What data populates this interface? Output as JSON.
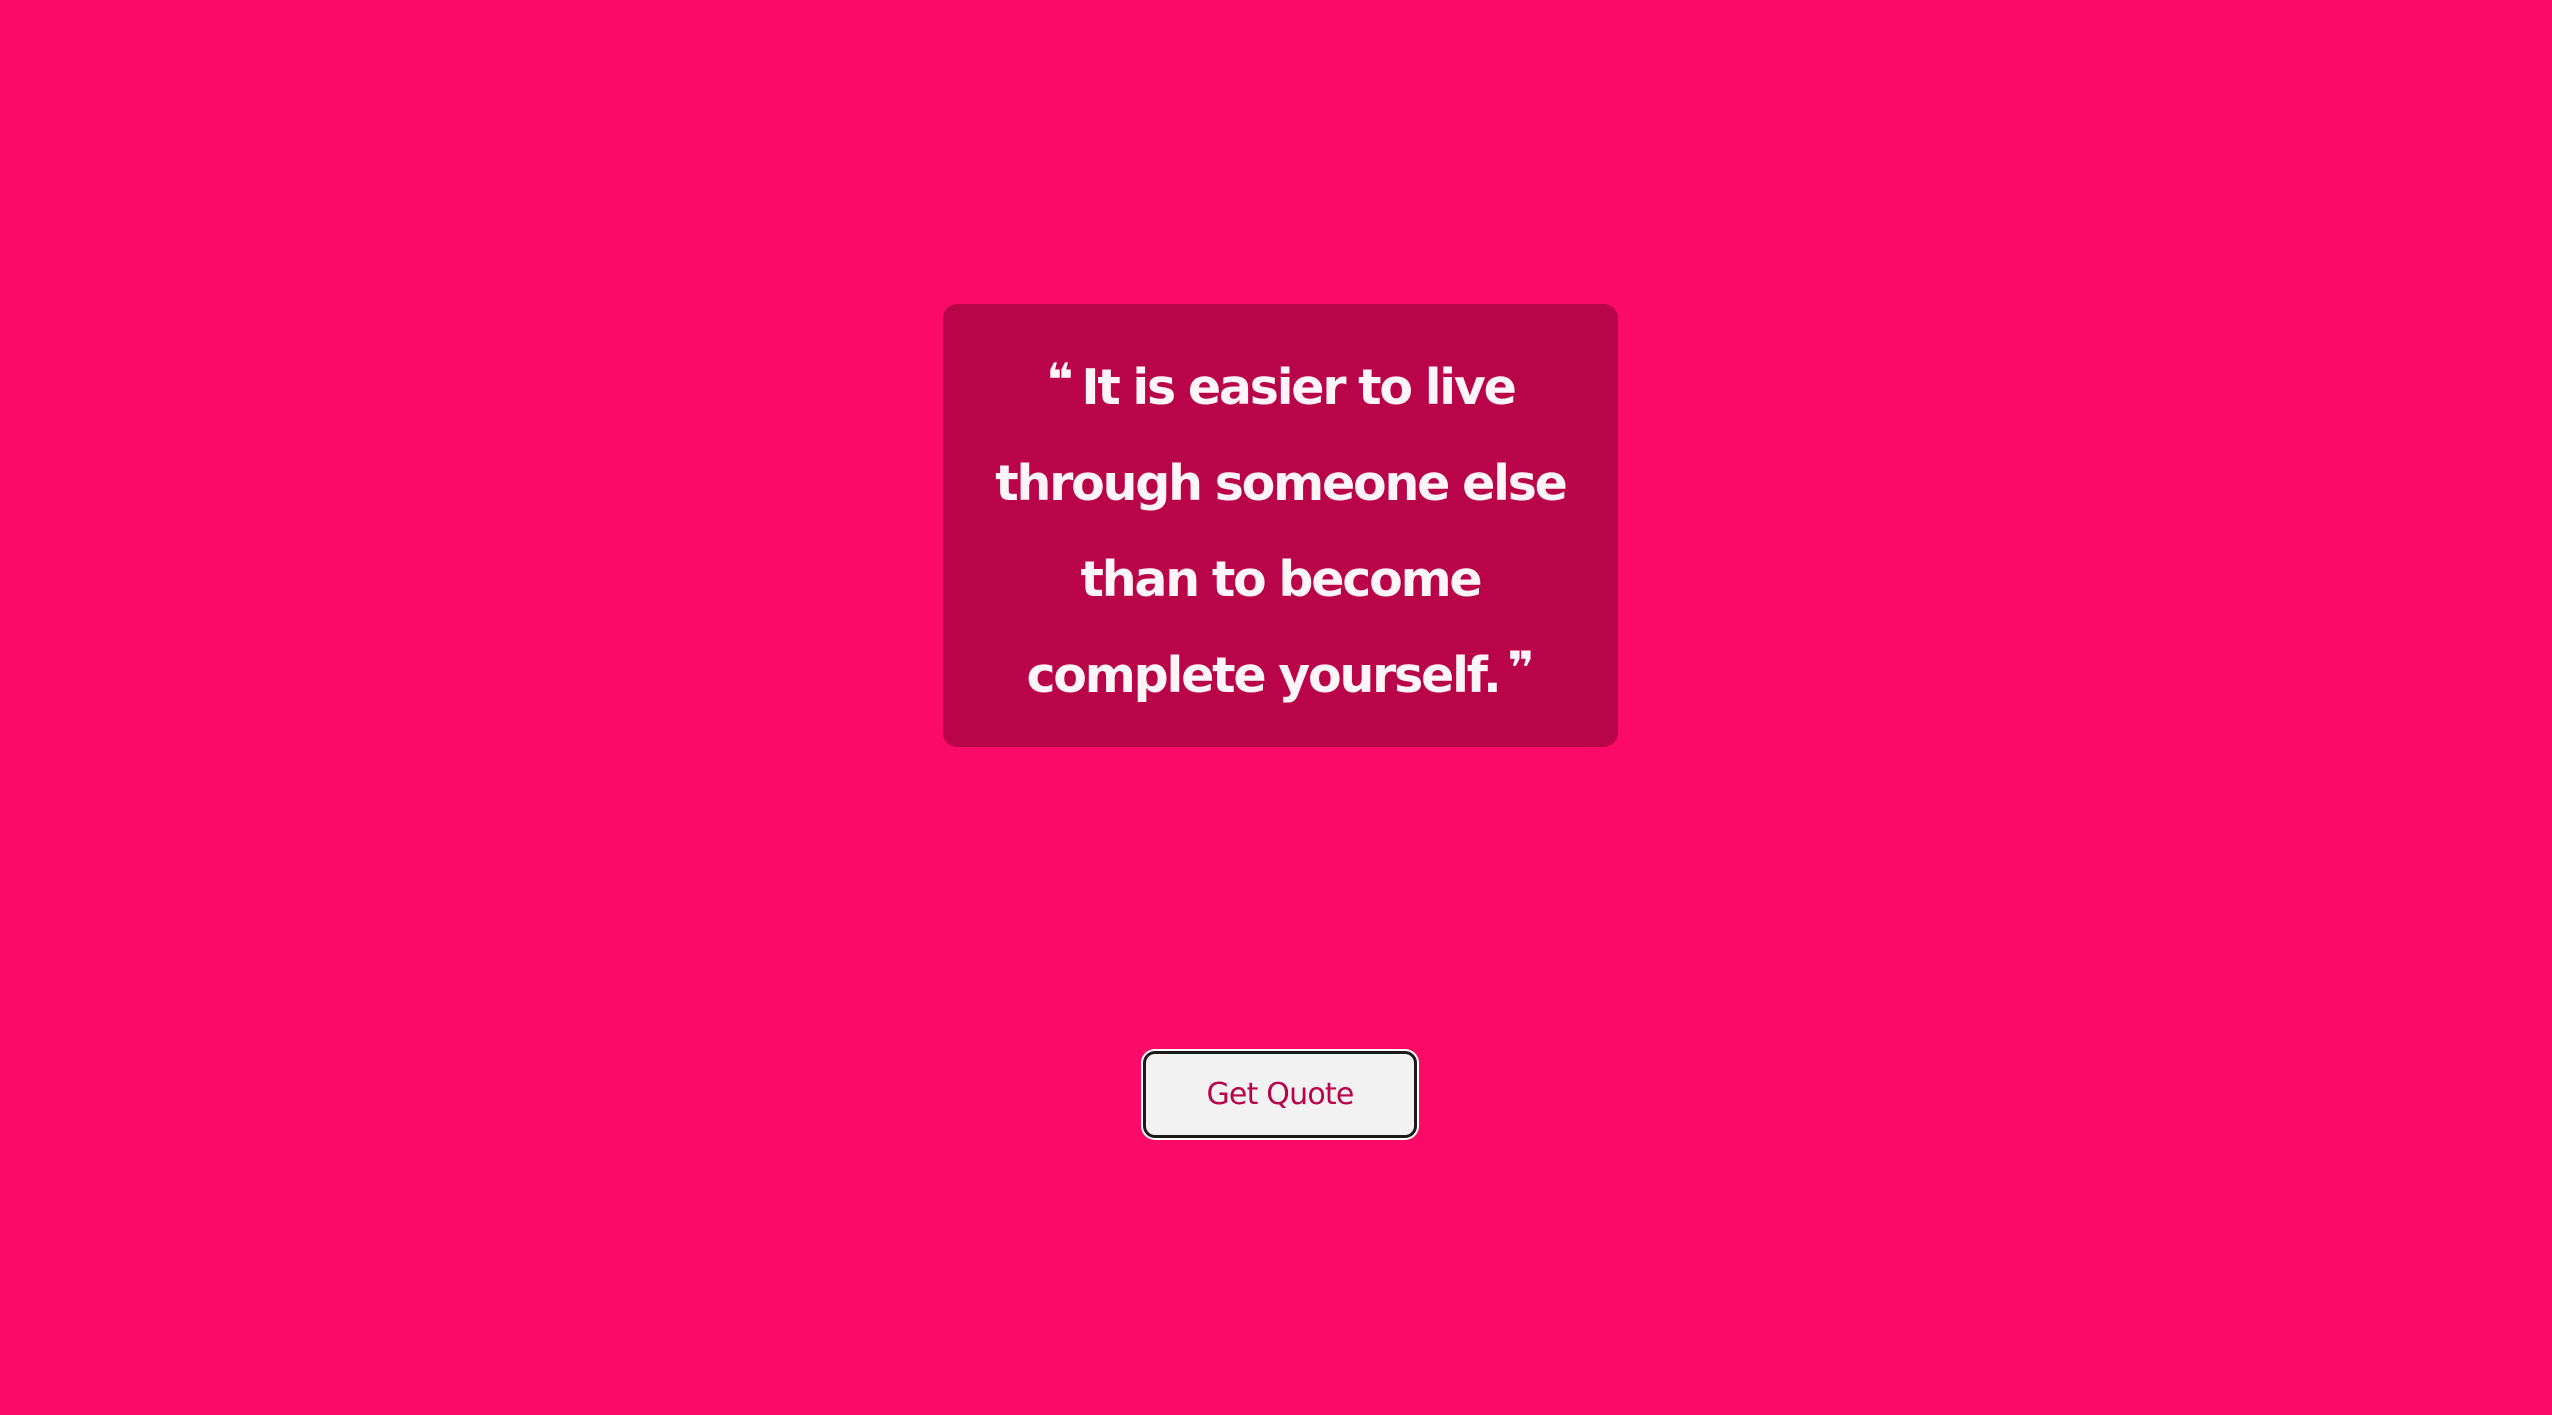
{
  "quote": {
    "open_mark": "❝",
    "text": "It is easier to live through someone else than to become complete yourself.",
    "close_mark": "❞"
  },
  "actions": {
    "get_quote_label": "Get Quote"
  },
  "colors": {
    "background": "#fb0b67",
    "card_background": "#b90449",
    "quote_text": "#fff4f7",
    "button_background": "#f2f2f2",
    "button_text": "#b90449"
  }
}
